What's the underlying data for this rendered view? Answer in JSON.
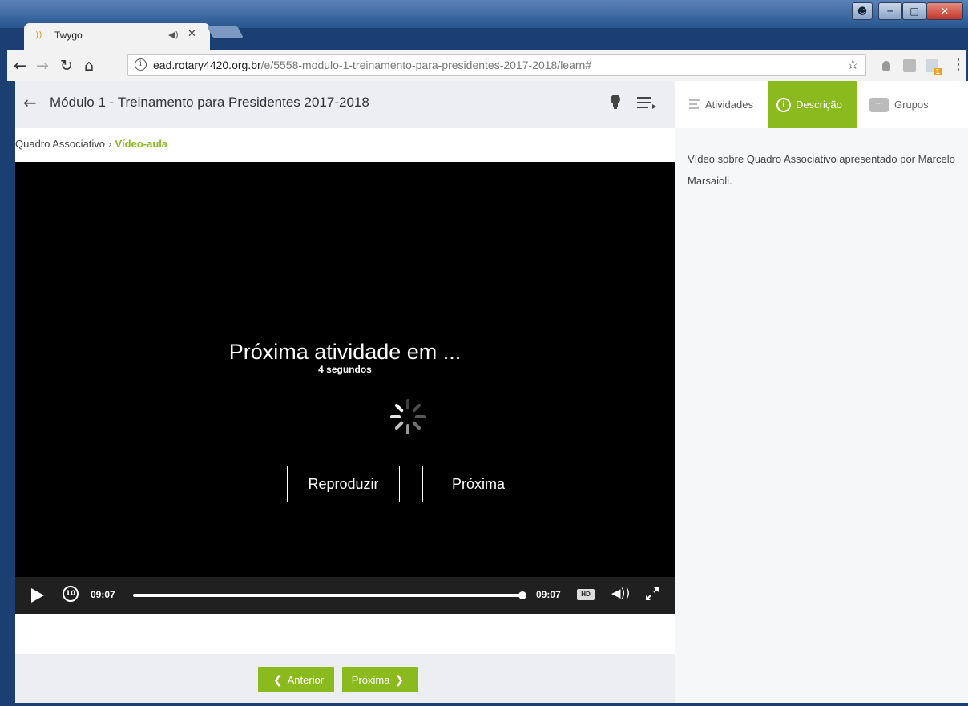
{
  "browser": {
    "tab_title": "Twygo",
    "tab_audio_glyph": "))",
    "tab_mute_glyph": "◀)",
    "tab_close_glyph": "✕",
    "url_host": "ead.rotary4420.org.br",
    "url_path": "/e/5558-modulo-1-treinamento-para-presidentes-2017-2018/learn#",
    "extension_badge": "1"
  },
  "header": {
    "title": "Módulo 1 - Treinamento para Presidentes 2017-2018"
  },
  "breadcrumb": {
    "parent": "Quadro Associativo",
    "separator": "›",
    "current": "Vídeo-aula"
  },
  "player": {
    "overlay_title": "Próxima atividade em ...",
    "overlay_subtitle": "4 segundos",
    "replay_label": "Reproduzir",
    "next_label": "Próxima",
    "rewind_label": "10",
    "current_time": "09:07",
    "duration": "09:07",
    "progress_percent": 100,
    "quality_badge": "HD"
  },
  "footer": {
    "prev_label": "Anterior",
    "next_label": "Próxima"
  },
  "side_panel": {
    "tabs": [
      {
        "label": "Atividades",
        "active": false
      },
      {
        "label": "Descrição",
        "active": true
      },
      {
        "label": "Grupos",
        "active": false
      }
    ],
    "description": "Vídeo sobre Quadro Associativo apresentado por Marcelo Marsaioli."
  },
  "colors": {
    "accent": "#8bba1f",
    "header_bg": "#eceef1",
    "player_bg": "#000000"
  }
}
